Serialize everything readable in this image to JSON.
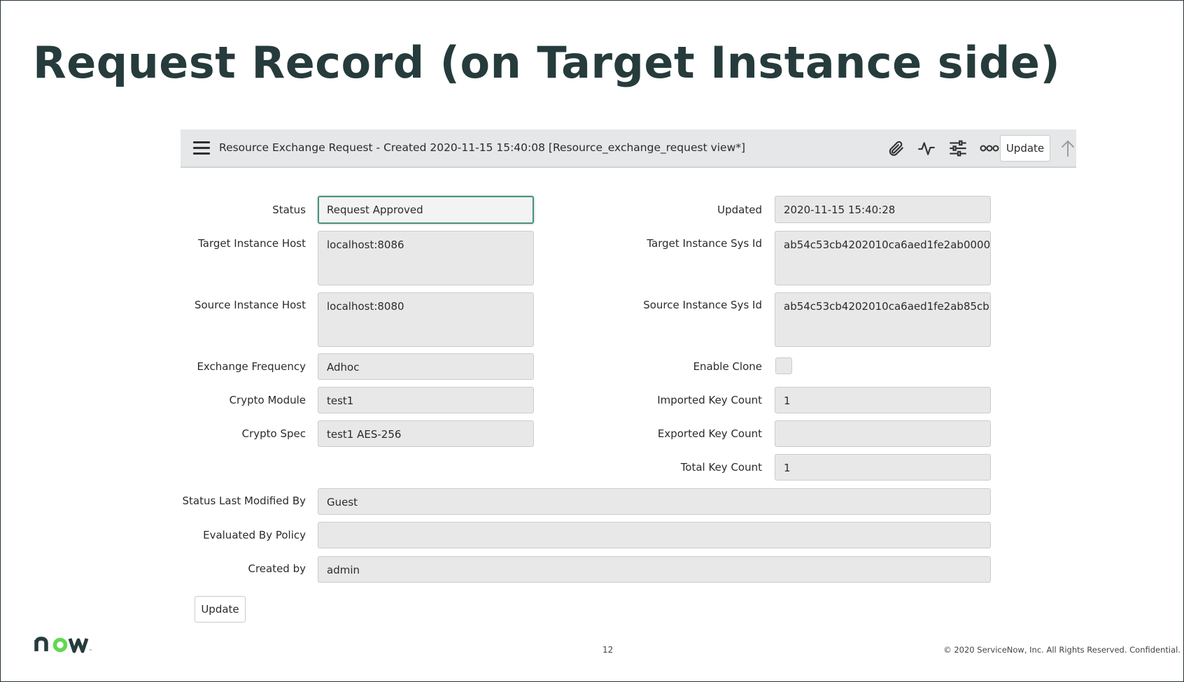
{
  "slide": {
    "title": "Request Record (on Target Instance side)",
    "page_number": "12",
    "footer_text": "© 2020 ServiceNow, Inc. All Rights Reserved. Confidential.",
    "logo_text": "now"
  },
  "form_header": {
    "title": "Resource Exchange Request - Created 2020-11-15 15:40:08 [Resource_exchange_request view*]",
    "update_label": "Update",
    "icons": [
      "menu-icon",
      "paperclip-icon",
      "activity-icon",
      "settings-sliders-icon",
      "more-icon",
      "arrow-up-icon"
    ]
  },
  "fields": {
    "status": {
      "label": "Status",
      "value": "Request Approved"
    },
    "target_instance_host": {
      "label": "Target Instance Host",
      "value": "localhost:8086"
    },
    "source_instance_host": {
      "label": "Source Instance Host",
      "value": "localhost:8080"
    },
    "exchange_frequency": {
      "label": "Exchange Frequency",
      "value": "Adhoc"
    },
    "crypto_module": {
      "label": "Crypto Module",
      "value": "test1"
    },
    "crypto_spec": {
      "label": "Crypto Spec",
      "value": "test1 AES-256"
    },
    "updated": {
      "label": "Updated",
      "value": "2020-11-15 15:40:28"
    },
    "target_instance_sys_id": {
      "label": "Target Instance Sys Id",
      "value": "ab54c53cb4202010ca6aed1fe2ab0000"
    },
    "source_instance_sys_id": {
      "label": "Source Instance Sys Id",
      "value": "ab54c53cb4202010ca6aed1fe2ab85cb"
    },
    "enable_clone": {
      "label": "Enable Clone",
      "checked": false
    },
    "imported_key_count": {
      "label": "Imported Key Count",
      "value": "1"
    },
    "exported_key_count": {
      "label": "Exported Key Count",
      "value": ""
    },
    "total_key_count": {
      "label": "Total Key Count",
      "value": "1"
    },
    "status_last_modified_by": {
      "label": "Status Last Modified By",
      "value": "Guest"
    },
    "evaluated_by_policy": {
      "label": "Evaluated By Policy",
      "value": ""
    },
    "created_by": {
      "label": "Created by",
      "value": "admin"
    }
  },
  "form_footer": {
    "update_label": "Update"
  },
  "colors": {
    "title": "#263b3c",
    "header_bg": "#e6e7e8",
    "field_bg": "#e8e8e8",
    "focus_border": "#4c8f80",
    "logo_accent": "#62d84e"
  }
}
